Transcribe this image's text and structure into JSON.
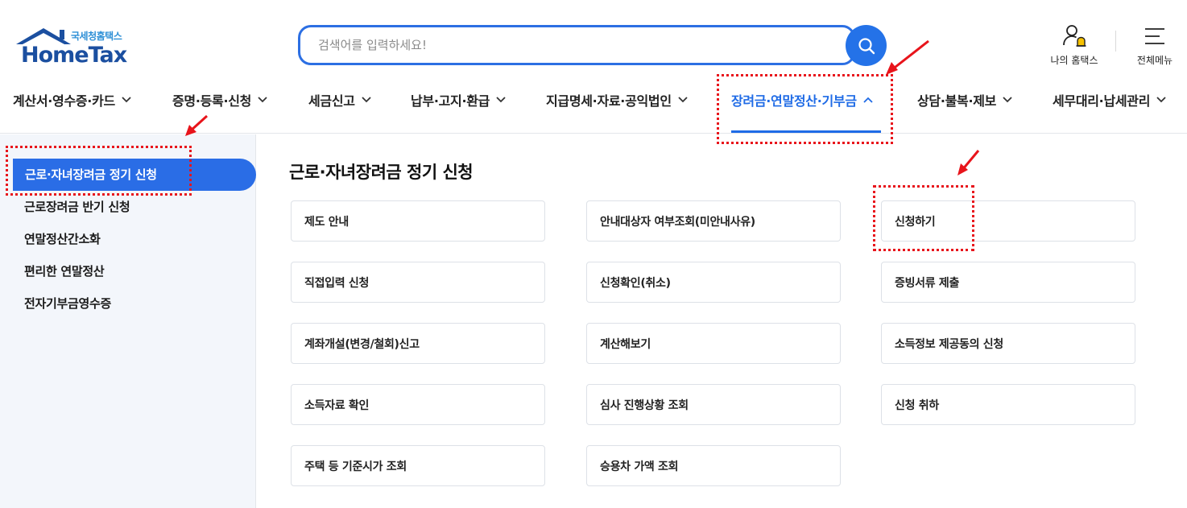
{
  "logo": {
    "korean": "국세청홈택스",
    "english": "HomeTax"
  },
  "search": {
    "placeholder": "검색어를 입력하세요!"
  },
  "utility": {
    "my_hometax": "나의 홈택스",
    "all_menu": "전체메뉴"
  },
  "gnb": [
    {
      "label": "계산서·영수증·카드",
      "expanded": false
    },
    {
      "label": "증명·등록·신청",
      "expanded": false
    },
    {
      "label": "세금신고",
      "expanded": false
    },
    {
      "label": "납부·고지·환급",
      "expanded": false
    },
    {
      "label": "지급명세·자료·공익법인",
      "expanded": false
    },
    {
      "label": "장려금·연말정산·기부금",
      "expanded": true
    },
    {
      "label": "상담·불복·제보",
      "expanded": false
    },
    {
      "label": "세무대리·납세관리",
      "expanded": false
    }
  ],
  "sidebar": {
    "active": "근로·자녀장려금 정기 신청",
    "items": [
      "근로장려금 반기 신청",
      "연말정산간소화",
      "편리한 연말정산",
      "전자기부금영수증"
    ]
  },
  "content": {
    "title": "근로·자녀장려금 정기 신청",
    "cards": [
      "제도 안내",
      "안내대상자 여부조회(미안내사유)",
      "신청하기",
      "직접입력 신청",
      "신청확인(취소)",
      "증빙서류 제출",
      "계좌개설(변경/철회)신고",
      "계산해보기",
      "소득정보 제공동의 신청",
      "소득자료 확인",
      "심사 진행상황 조회",
      "신청 취하",
      "주택 등 기준시가 조회",
      "승용차 가액 조회"
    ]
  },
  "colors": {
    "accent": "#1f6be6",
    "annotation": "#e8141b",
    "sidebar_bg": "#f3f6fb"
  }
}
